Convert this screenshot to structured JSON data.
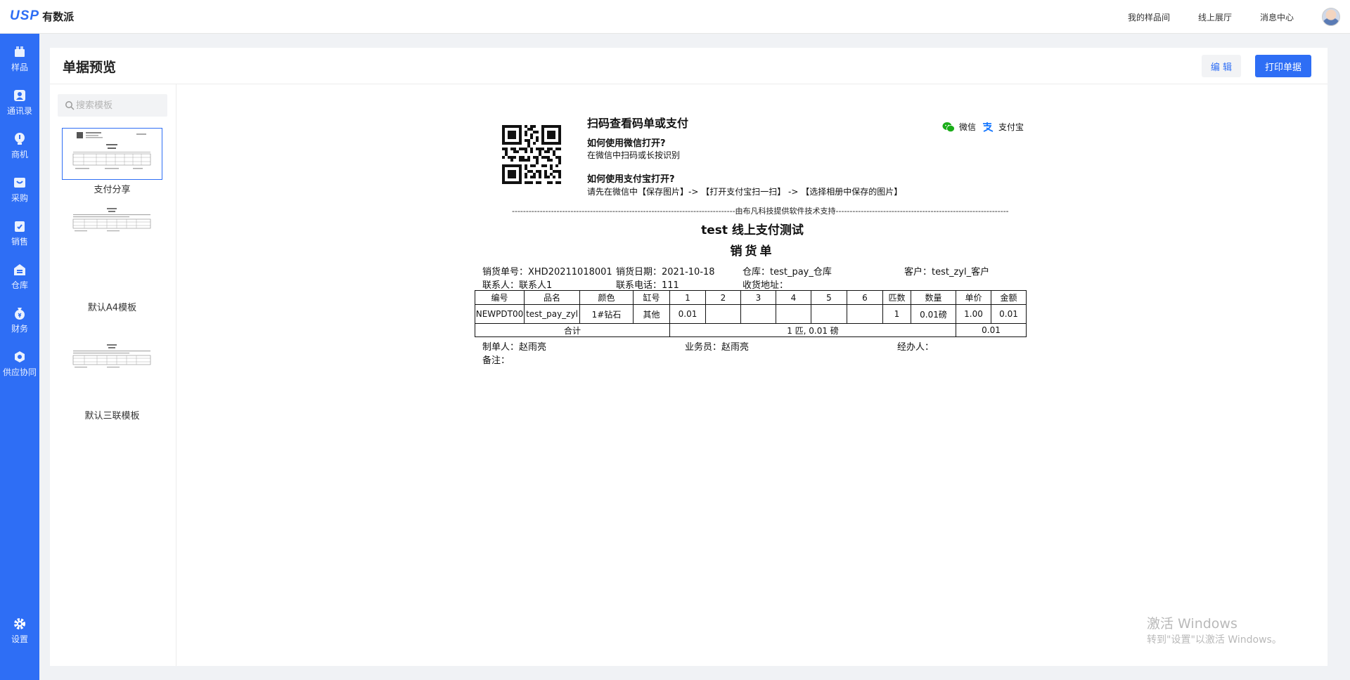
{
  "app": {
    "logo_text": "USP",
    "brand": "有数派"
  },
  "topnav": {
    "items": [
      "我的样品间",
      "线上展厅",
      "消息中心"
    ]
  },
  "sidebar": {
    "items": [
      {
        "label": "样品",
        "icon": "box-icon"
      },
      {
        "label": "通讯录",
        "icon": "contacts-icon"
      },
      {
        "label": "商机",
        "icon": "bulb-icon"
      },
      {
        "label": "采购",
        "icon": "cart-icon"
      },
      {
        "label": "销售",
        "icon": "clipboard-icon"
      },
      {
        "label": "仓库",
        "icon": "warehouse-icon"
      },
      {
        "label": "财务",
        "icon": "money-bag-icon"
      },
      {
        "label": "供应协同",
        "icon": "cooperation-icon"
      }
    ],
    "settings_label": "设置"
  },
  "page": {
    "title": "单据预览",
    "edit_label": "编 辑",
    "print_label": "打印单据"
  },
  "search": {
    "placeholder": "搜索模板",
    "value": ""
  },
  "templates": [
    {
      "name": "支付分享",
      "active": true
    },
    {
      "name": "默认A4模板",
      "active": false
    },
    {
      "name": "默认三联模板",
      "active": false
    }
  ],
  "document": {
    "scan_title": "扫码查看码单或支付",
    "wechat_question": "如何使用微信打开?",
    "wechat_answer": "在微信中扫码或长按识别",
    "alipay_question": "如何使用支付宝打开?",
    "alipay_answer": "请先在微信中【保存图片】-> 【打开支付宝扫一扫】 -> 【选择相册中保存的图片】",
    "wechat_label": "微信",
    "alipay_label": "支付宝",
    "divider": "--------------------------------------------------------------------------------由布凡科技提供软件技术支持----------------------------------------------------------------------------",
    "title": "test 线上支付测试",
    "subtitle": "销货单",
    "order_no": "销货单号：XHD20211018001",
    "order_date": "销货日期：2021-10-18",
    "warehouse": "仓库：test_pay_仓库",
    "customer": "客户：test_zyl_客户",
    "contact": "联系人：联系人1",
    "phone": "联系电话：111",
    "address": "收货地址：",
    "table": {
      "headers": [
        "编号",
        "品名",
        "颜色",
        "缸号",
        "1",
        "2",
        "3",
        "4",
        "5",
        "6",
        "匹数",
        "数量",
        "单价",
        "金额"
      ],
      "rows": [
        [
          "NEWPDT00",
          "test_pay_zyl",
          "1#钻石",
          "其他",
          "0.01",
          "",
          "",
          "",
          "",
          "",
          "1",
          "0.01磅",
          "1.00",
          "0.01"
        ]
      ],
      "total_label": "合计",
      "total_qty": "1 匹, 0.01 磅",
      "total_amount": "0.01"
    },
    "maker": "制单人：赵雨亮",
    "salesman": "业务员：赵雨亮",
    "handler": "经办人：",
    "remark": "备注："
  },
  "watermark": {
    "line1": "激活 Windows",
    "line2": "转到\"设置\"以激活 Windows。"
  }
}
